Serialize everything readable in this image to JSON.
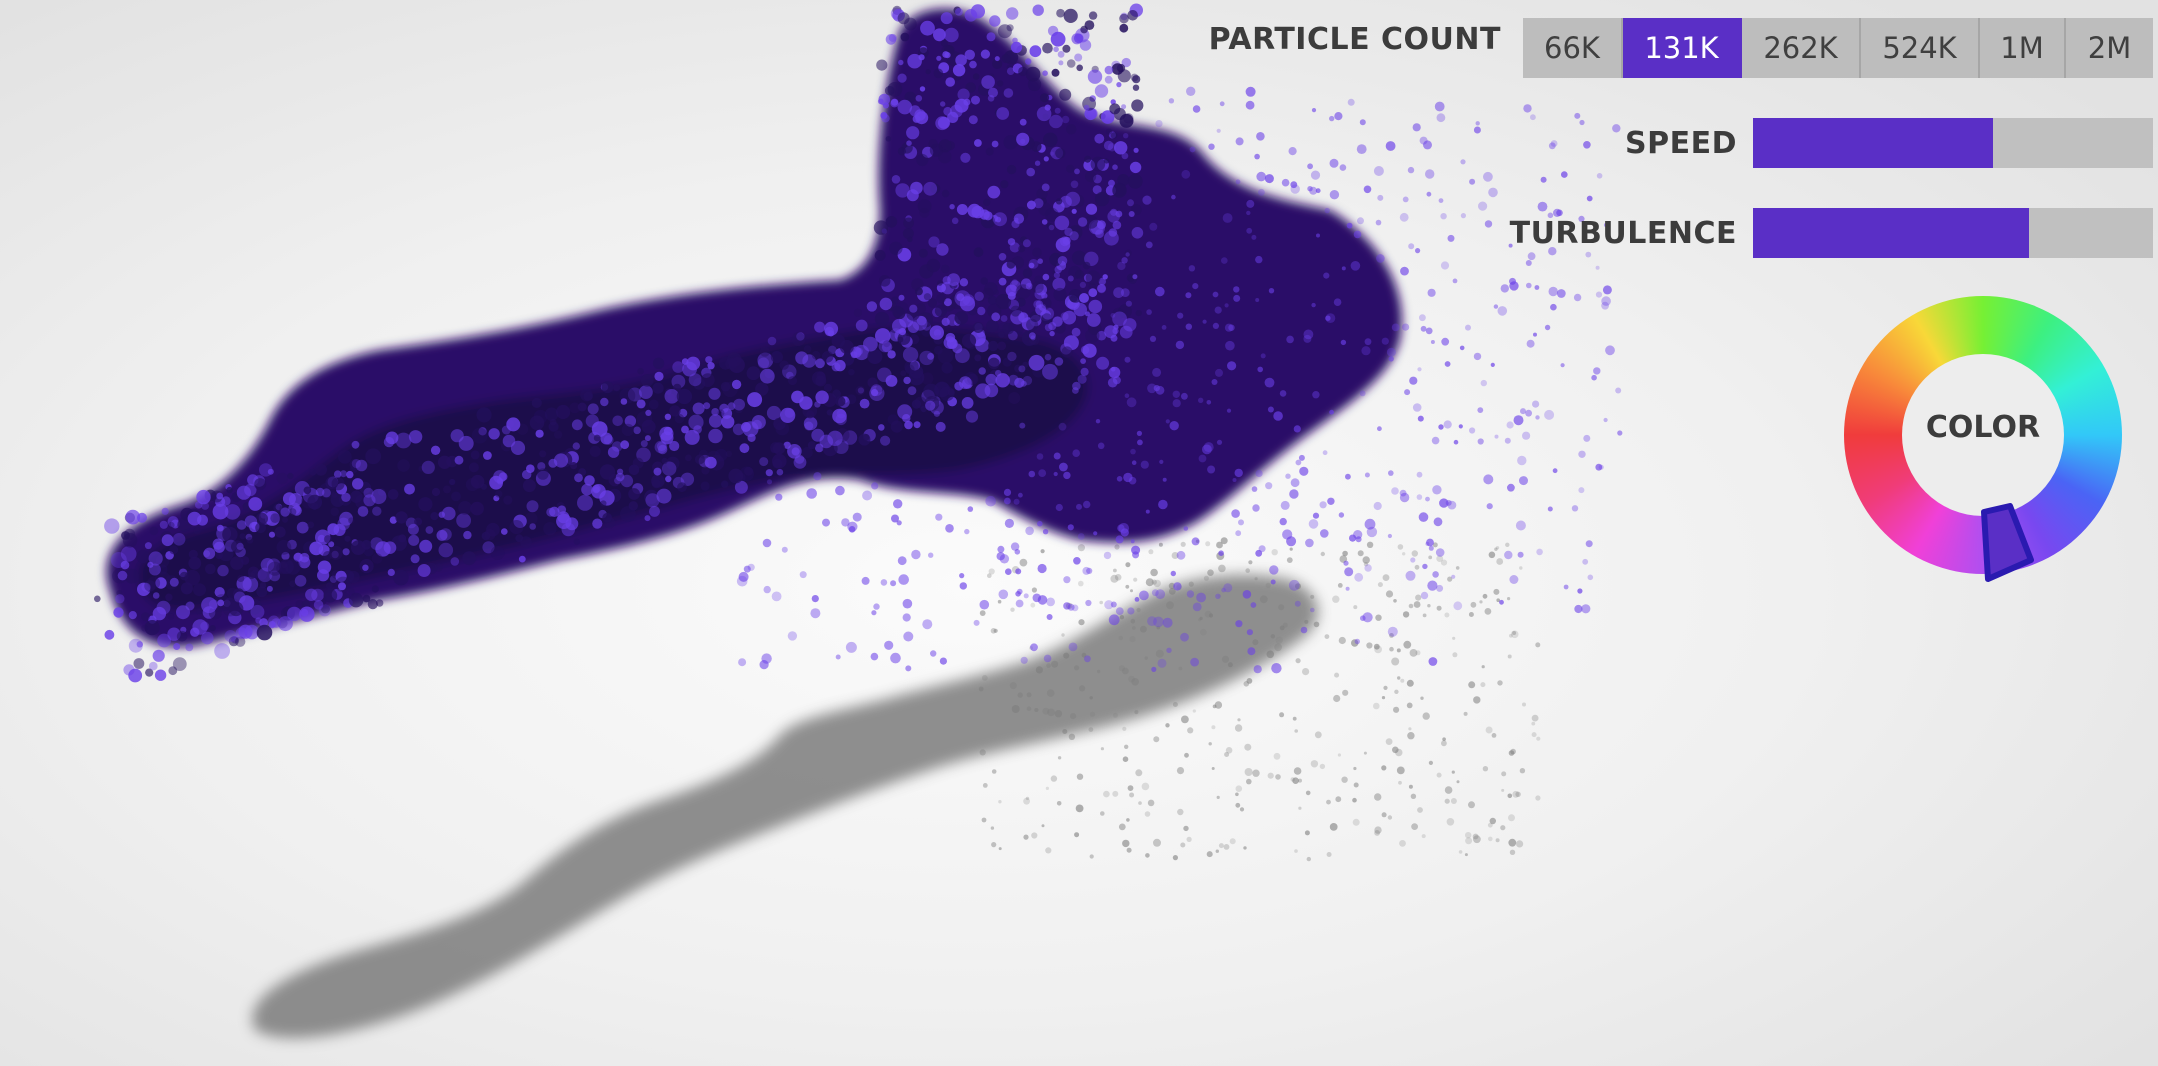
{
  "controls": {
    "particle_count": {
      "label": "PARTICLE COUNT",
      "options": [
        "66K",
        "131K",
        "262K",
        "524K",
        "1M",
        "2M"
      ],
      "selected": "131K"
    },
    "speed": {
      "label": "SPEED",
      "value": 0.6
    },
    "turbulence": {
      "label": "TURBULENCE",
      "value": 0.69
    },
    "color": {
      "label": "COLOR",
      "selected_hue_color": "#5a2fc6"
    }
  },
  "colors": {
    "accent": "#5a2fc6",
    "particle_dark": "#24105e",
    "particle_light": "#6a3fe8",
    "shadow": "#7c7c7c",
    "track": "#c0c0c0"
  },
  "icons": {
    "color_handle": "color-selector-handle-icon"
  }
}
